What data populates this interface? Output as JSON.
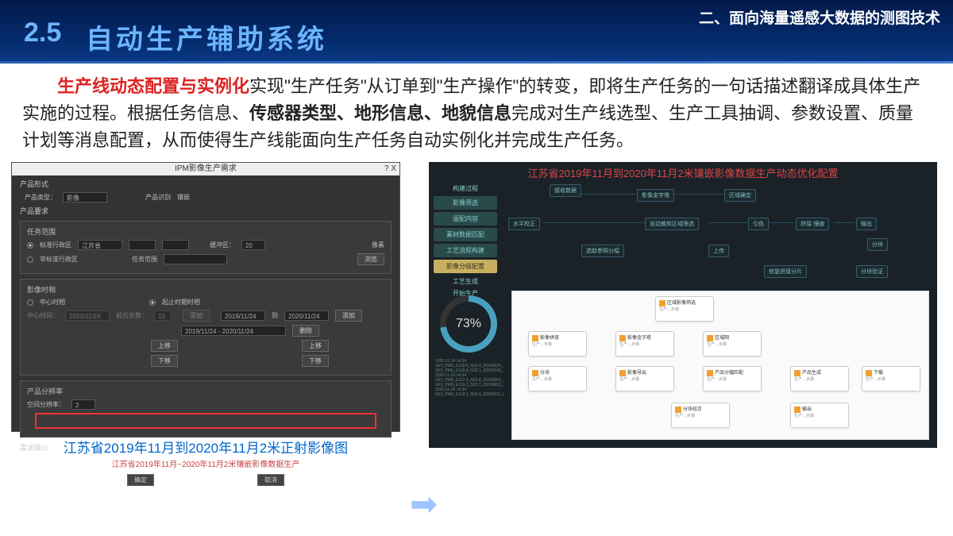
{
  "header": {
    "section_num": "2.5",
    "section_title": "自动生产辅助系统",
    "chapter": "二、面向海量遥感大数据的测图技术"
  },
  "para": {
    "red_lead": "生产线动态配置与实例化",
    "t1": "实现\"生产任务\"从订单到\"生产操作\"的转变，即将生产任务的一句话描述翻译成具体生产实施的过程。根据任务信息、",
    "b1": "传感器类型、地形信息、地貌信息",
    "t2": "完成对生产线选型、生产工具抽调、参数设置、质量计划等消息配置，从而使得生产线能面向生产任务自动实例化并完成生产任务。"
  },
  "left": {
    "win_title": "IPM影像生产需求",
    "qx": "?  X",
    "sec1": "产品形式",
    "type_l": "产品类型：",
    "type_v": "影像",
    "brand_l": "产品识别",
    "brand_v": "镶嵌",
    "sec2": "产品要求",
    "task_scope": "任务范围",
    "std_admin": "标准行政区",
    "prov": "江苏省",
    "buf_l": "缓冲区：",
    "buf_v": "20",
    "px": "像素",
    "nonstd": "非标准行政区",
    "scope_lbl": "任务范围",
    "browse": "浏览",
    "img_time": "影像时相",
    "center_time": "中心时相",
    "center_date": "2020/11/24",
    "days_l": "前后天数：",
    "days_v": "10",
    "range_time": "起止时期时相",
    "from": "2019/11/24",
    "to_l": "到",
    "to": "2020/11/24",
    "range_disp": "2019/11/24 - 2020/11/24",
    "add": "添加",
    "del": "删除",
    "up": "上移",
    "down": "下移",
    "res_sec": "产品分辨率",
    "res_l": "空间分辨率：",
    "res_v": "2",
    "confirm_sec": "需求确认",
    "redline": "江苏省2019年11月~2020年11月2米镶嵌影像数据生产",
    "ok": "确定",
    "cancel": "取消",
    "caption": "江苏省2019年11月到2020年11月2米正射影像图"
  },
  "right": {
    "title": "江苏省2019年11月到2020年11月2米镶嵌影像数据生产动态优化配置",
    "side_h": "构建过程",
    "side_items": [
      "影像筛选",
      "遥配内容",
      "素材数据匹配",
      "工艺流程构建",
      "影像分级配置"
    ],
    "side_txt1": "工艺生成",
    "side_txt2": "开始生产",
    "nodes": {
      "n1": "接收数据",
      "n2": "影像金字塔",
      "n3": "区域确定",
      "n4": "水平校正",
      "n5": "自动裁剪区域筛选",
      "n6": "匀色",
      "n7": "拼接·镶嵌",
      "n8": "输出",
      "n9": "选取参照分幅",
      "n10": "上传",
      "n11": "分块",
      "n12": "修复拼接分片",
      "n13": "分块验证"
    },
    "pct": "73%",
    "log_lines": "2020-11-24 14:34\nGF2_PMS_E118.6_N32.4_20200624_L1A00...\nGF2_PMS_E118.8_N33.1_20200108_L1A00...\n2020-11-24 14:34\nGF2_PMS_E117.9_N31.8_20200502_L1A00...\nGF2_PMS_E119.2_N32.7_20200815_L1A00...\n2020-11-24 14:34\nGF2_PMS_E118.1_N33.5_20200311_L1A00...",
    "w": {
      "w1": "区域影像筛选",
      "w2": "影像拼接",
      "w3": "影像金字塔",
      "w4": "区域网",
      "w5": "分块",
      "w6": "影像导出",
      "w7": "产品分幅匹配",
      "w8": "产品生成",
      "w9": "下载",
      "w10": "分块校正",
      "w11": "输出"
    },
    "sub": "生产…步骤"
  }
}
